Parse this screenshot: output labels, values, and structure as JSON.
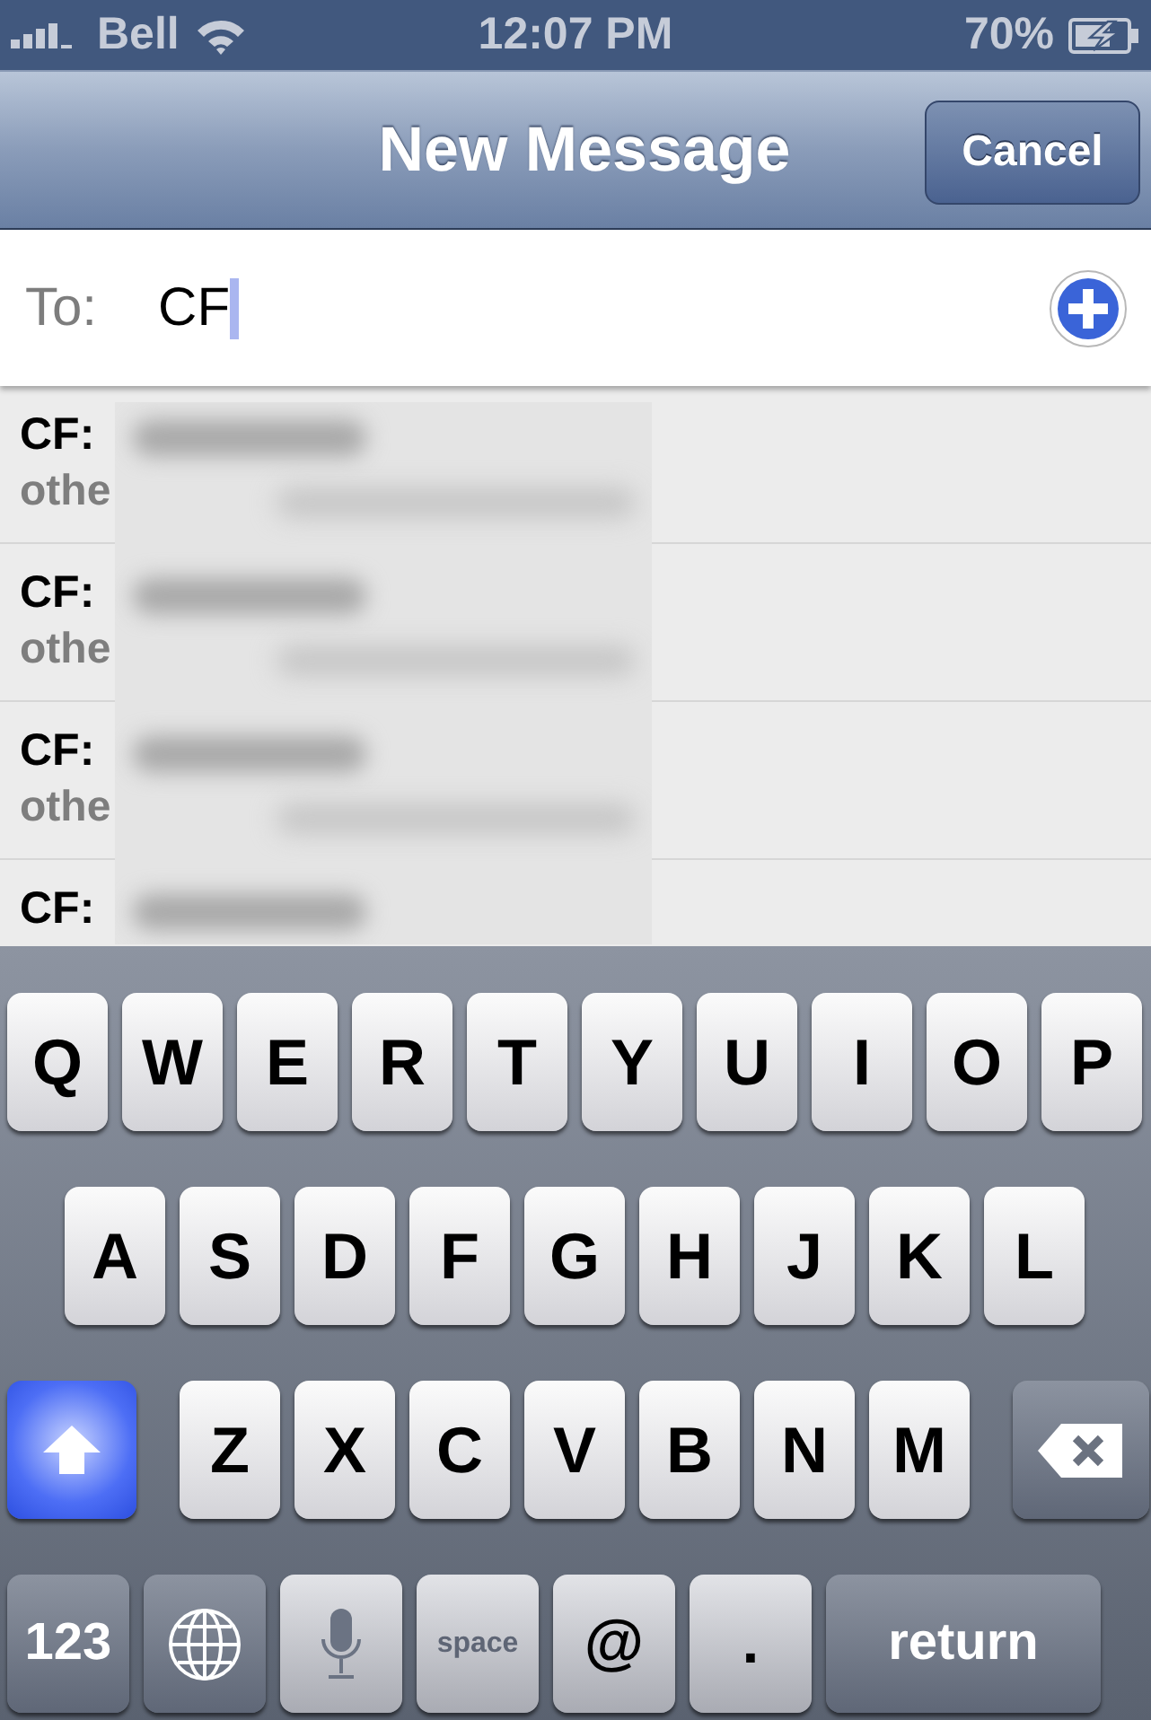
{
  "status_bar": {
    "carrier": "Bell",
    "time": "12:07 PM",
    "battery": "70%",
    "charging": true
  },
  "nav_bar": {
    "title": "New Message",
    "button": "Cancel"
  },
  "to_field": {
    "label": "To:",
    "value": "CF"
  },
  "suggestions": [
    {
      "prefix": "CF:",
      "detail": "othe"
    },
    {
      "prefix": "CF:",
      "detail": "othe"
    },
    {
      "prefix": "CF:",
      "detail": "othe"
    },
    {
      "prefix": "CF:"
    }
  ],
  "keyboard": {
    "rows": [
      [
        {
          "kind": "letter",
          "label": "Q"
        },
        {
          "kind": "letter",
          "label": "W"
        },
        {
          "kind": "letter",
          "label": "E"
        },
        {
          "kind": "letter",
          "label": "R"
        },
        {
          "kind": "letter",
          "label": "T"
        },
        {
          "kind": "letter",
          "label": "Y"
        },
        {
          "kind": "letter",
          "label": "U"
        },
        {
          "kind": "letter",
          "label": "I"
        },
        {
          "kind": "letter",
          "label": "O"
        },
        {
          "kind": "letter",
          "label": "P"
        }
      ],
      [
        {
          "kind": "letter",
          "label": "A"
        },
        {
          "kind": "letter",
          "label": "S"
        },
        {
          "kind": "letter",
          "label": "D"
        },
        {
          "kind": "letter",
          "label": "F"
        },
        {
          "kind": "letter",
          "label": "G"
        },
        {
          "kind": "letter",
          "label": "H"
        },
        {
          "kind": "letter",
          "label": "J"
        },
        {
          "kind": "letter",
          "label": "K"
        },
        {
          "kind": "letter",
          "label": "L"
        }
      ],
      [
        {
          "kind": "shift",
          "on": true
        },
        {
          "kind": "letter",
          "label": "Z"
        },
        {
          "kind": "letter",
          "label": "X"
        },
        {
          "kind": "letter",
          "label": "C"
        },
        {
          "kind": "letter",
          "label": "V"
        },
        {
          "kind": "letter",
          "label": "B"
        },
        {
          "kind": "letter",
          "label": "N"
        },
        {
          "kind": "letter",
          "label": "M"
        },
        {
          "kind": "delete"
        }
      ]
    ],
    "bottom_row": [
      {
        "kind": "mode",
        "label": "123"
      },
      {
        "kind": "globe"
      },
      {
        "kind": "mic"
      },
      {
        "kind": "space",
        "label": "space"
      },
      {
        "kind": "symbol",
        "label": "@"
      },
      {
        "kind": "symbol",
        "label": "."
      },
      {
        "kind": "return",
        "label": "return"
      }
    ]
  }
}
